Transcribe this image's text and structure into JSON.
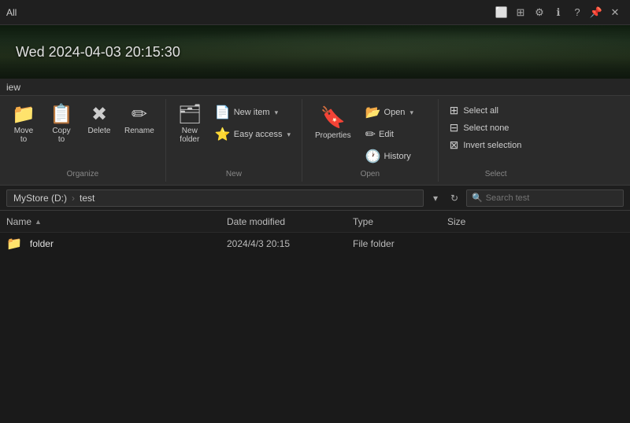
{
  "titlebar": {
    "text": "All",
    "icons": [
      "monitor-icon",
      "grid-icon",
      "settings-icon",
      "info-icon",
      "help-icon",
      "pin-icon",
      "close-icon"
    ]
  },
  "hero": {
    "datetime": "Wed 2024-04-03 20:15:30"
  },
  "ribbon": {
    "view_label": "iew",
    "groups": {
      "organize": {
        "label": "Organize",
        "move_to": "Move\nto",
        "copy_to": "Copy\nto",
        "delete": "Delete",
        "rename": "Rename"
      },
      "new": {
        "label": "New",
        "new_item": "New item",
        "easy_access": "Easy access",
        "new_folder": "New\nfolder"
      },
      "open": {
        "label": "Open",
        "open": "Open",
        "edit": "Edit",
        "history": "History",
        "properties": "Properties"
      },
      "select": {
        "label": "Select",
        "select_all": "Select all",
        "select_none": "Select none",
        "invert": "Invert selection"
      }
    }
  },
  "addressbar": {
    "path": "MyStore (D:)",
    "subfolder": "test",
    "search_placeholder": "Search test"
  },
  "filelist": {
    "columns": {
      "name": "Name",
      "date_modified": "Date modified",
      "type": "Type",
      "size": "Size"
    },
    "files": [
      {
        "name": "folder",
        "date_modified": "2024/4/3 20:15",
        "type": "File folder",
        "size": ""
      }
    ]
  }
}
